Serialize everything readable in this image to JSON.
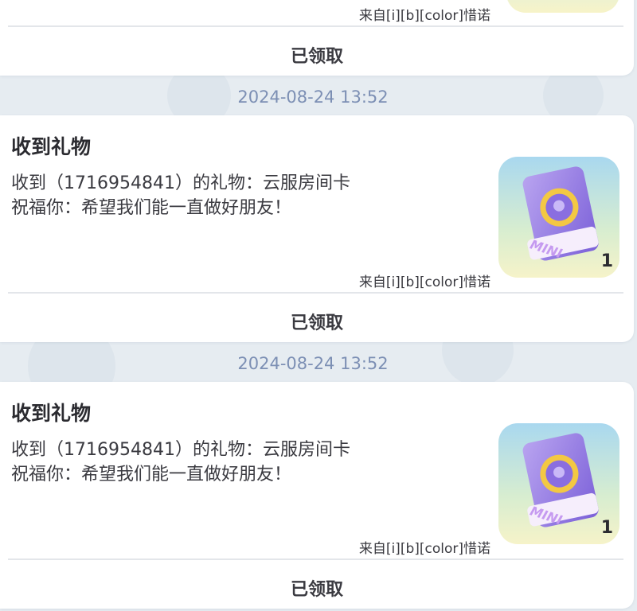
{
  "messages": [
    {
      "title": "",
      "line1": "",
      "line2": "",
      "sender": "来自[i][b][color]惜诺",
      "status": "已领取",
      "gift_count": ""
    },
    {
      "timestamp": "2024-08-24 13:52",
      "title": "收到礼物",
      "line1": "收到（1716954841）的礼物：云服房间卡",
      "line2": "祝福你：希望我们能一直做好朋友！",
      "sender": "来自[i][b][color]惜诺",
      "status": "已领取",
      "gift_label": "MINI",
      "gift_count": "1"
    },
    {
      "timestamp": "2024-08-24 13:52",
      "title": "收到礼物",
      "line1": "收到（1716954841）的礼物：云服房间卡",
      "line2": "祝福你：希望我们能一直做好朋友！",
      "sender": "来自[i][b][color]惜诺",
      "status": "已领取",
      "gift_label": "MINI",
      "gift_count": "1"
    }
  ],
  "colors": {
    "background": "#e6ecf1",
    "card": "#ffffff",
    "timestamp": "#7c8fb4",
    "text": "#3a3a40"
  },
  "icons": {
    "gift": "room-card-ticket-icon"
  }
}
